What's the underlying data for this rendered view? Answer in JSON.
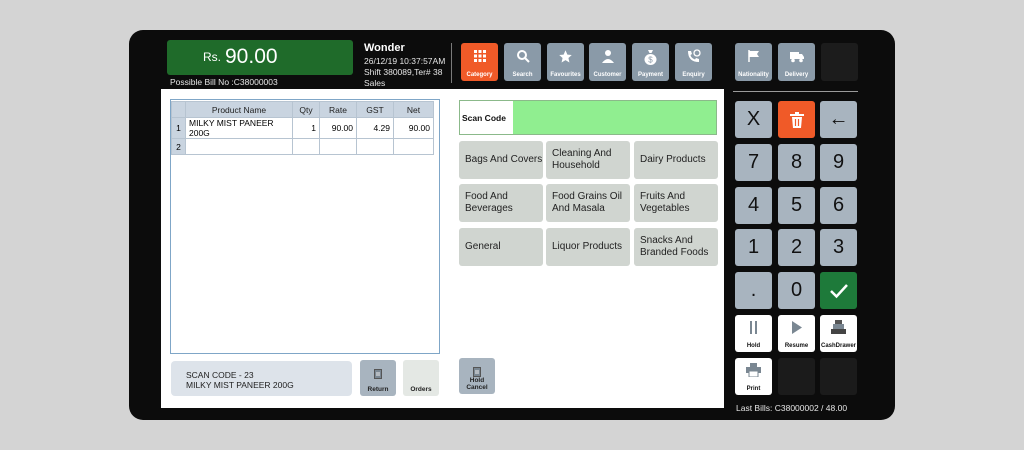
{
  "amount": {
    "currency": "Rs.",
    "value": "90.00"
  },
  "possible_bill": "Possible Bill No :C38000003",
  "store": {
    "name": "Wonder",
    "datetime": "26/12/19  10:37:57AM",
    "shift": "Shift 380089,Ter# 38",
    "mode": "Sales"
  },
  "toolbar": [
    {
      "label": "Category",
      "icon": "grid-icon"
    },
    {
      "label": "Search",
      "icon": "search-icon"
    },
    {
      "label": "Favourites",
      "icon": "star-icon"
    },
    {
      "label": "Customer",
      "icon": "person-icon"
    },
    {
      "label": "Payment",
      "icon": "money-bag-icon"
    },
    {
      "label": "Enquiry",
      "icon": "phone-icon"
    }
  ],
  "right_toolbar": [
    {
      "label": "Nationality",
      "icon": "flag-icon"
    },
    {
      "label": "Delivery",
      "icon": "truck-icon"
    },
    {
      "label": "",
      "icon": "blank"
    }
  ],
  "grid": {
    "headers": [
      "Product Name",
      "Qty",
      "Rate",
      "GST",
      "Net"
    ],
    "rows": [
      {
        "n": "1",
        "name": "MILKY MIST PANEER 200G",
        "qty": "1",
        "rate": "90.00",
        "gst": "4.29",
        "net": "90.00"
      },
      {
        "n": "2",
        "name": "",
        "qty": "",
        "rate": "",
        "gst": "",
        "net": ""
      }
    ]
  },
  "scan": {
    "label": "Scan Code",
    "value": ""
  },
  "categories": [
    "Bags And Covers",
    "Cleaning And Household",
    "Dairy Products",
    "Food And Beverages",
    "Food Grains Oil And Masala",
    "Fruits And Vegetables",
    "General",
    "Liquor Products",
    "Snacks And Branded Foods"
  ],
  "message": {
    "line1": "SCAN CODE - 23",
    "line2": "MILKY MIST PANEER 200G"
  },
  "bottom_buttons": {
    "return": "Return",
    "orders": "Orders",
    "hold_cancel": "Hold Cancel"
  },
  "keypad": [
    "X",
    "",
    "←",
    "7",
    "8",
    "9",
    "4",
    "5",
    "6",
    "1",
    "2",
    "3",
    ".",
    "0",
    ""
  ],
  "functions": {
    "hold": "Hold",
    "resume": "Resume",
    "cashdrawer": "CashDrawer",
    "print": "Print"
  },
  "last_bills": "Last Bills: C38000002 / 48.00",
  "colors": {
    "accent": "#f05a28",
    "amount_bg": "#1f6b2a",
    "scan_bg": "#90ee90",
    "key_bg": "#a8b4bf",
    "enter": "#1e7a3a"
  }
}
